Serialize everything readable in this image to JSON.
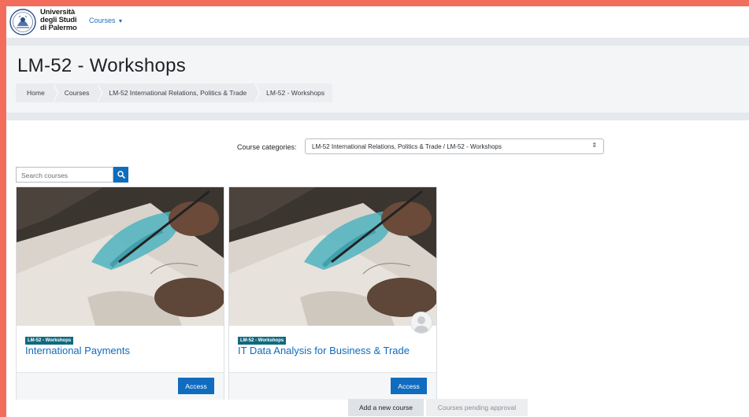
{
  "navbar": {
    "logo_lines": [
      "Università",
      "degli Studi",
      "di Palermo"
    ],
    "courses_menu": "Courses"
  },
  "header": {
    "title": "LM-52 - Workshops",
    "breadcrumb": [
      "Home",
      "Courses",
      "LM-52 International Relations, Politics & Trade",
      "LM-52 - Workshops"
    ]
  },
  "filters": {
    "category_label": "Course categories:",
    "category_selected": "LM-52 International Relations, Politics & Trade / LM-52 - Workshops",
    "search_placeholder": "Search courses"
  },
  "courses": [
    {
      "category_badge": "LM-52 - Workshops",
      "title": "International Payments",
      "action": "Access"
    },
    {
      "category_badge": "LM-52 - Workshops",
      "title": "IT Data Analysis for Business & Trade",
      "action": "Access"
    }
  ],
  "actions": {
    "add_course": "Add a new course",
    "pending": "Courses pending approval"
  },
  "colors": {
    "outer_border": "#f26d5b",
    "primary": "#0f6cbf",
    "badge": "#0f6a7f"
  },
  "icons": [
    "university-seal-icon",
    "caret-down-icon",
    "search-icon",
    "chevron-updown-icon",
    "user-avatar-icon"
  ]
}
